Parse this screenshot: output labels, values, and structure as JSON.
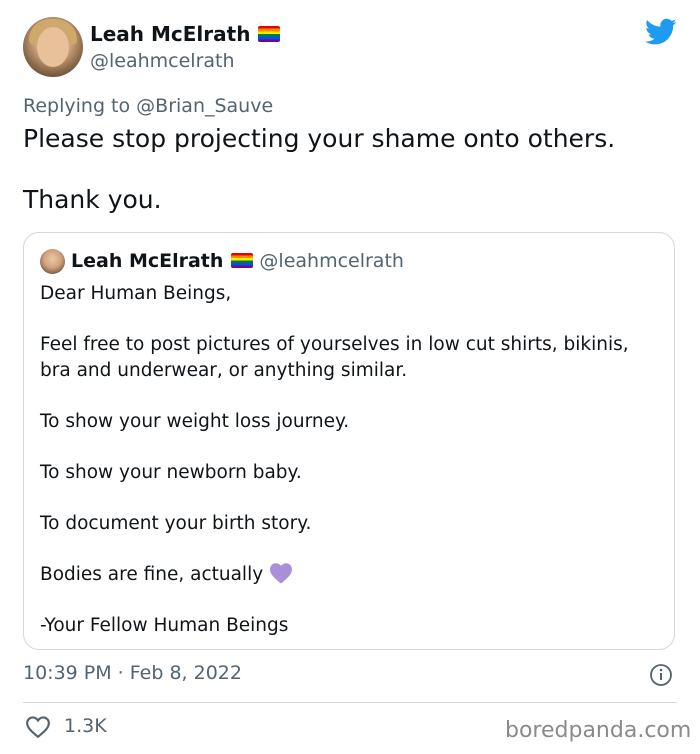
{
  "author": {
    "display_name": "Leah McElrath",
    "handle": "@leahmcelrath"
  },
  "replying": {
    "prefix": "Replying to",
    "mention": "@Brian_Sauve"
  },
  "tweet": {
    "line1": "Please stop projecting your shame onto others.",
    "line2": "Thank you."
  },
  "quote": {
    "display_name": "Leah McElrath",
    "handle": "@leahmcelrath",
    "lines": [
      "Dear Human Beings,",
      "Feel free to post pictures of yourselves in low cut shirts, bikinis, bra and underwear, or anything similar.",
      "To show your weight loss journey.",
      "To show your newborn baby.",
      "To document your birth story.",
      "Bodies are fine, actually",
      "-Your Fellow Human Beings"
    ]
  },
  "meta": {
    "timestamp": "10:39 PM · Feb 8, 2022",
    "likes": "1.3K"
  },
  "watermark": "boredpanda.com",
  "icons": [
    "twitter-bird-icon",
    "pride-flag-icon",
    "purple-heart-icon",
    "info-icon",
    "heart-outline-icon"
  ],
  "colors": {
    "twitter_blue": "#1d9bf0",
    "secondary_text": "#536471",
    "border": "#cfd9de",
    "purple_heart": "#a98fd8"
  }
}
